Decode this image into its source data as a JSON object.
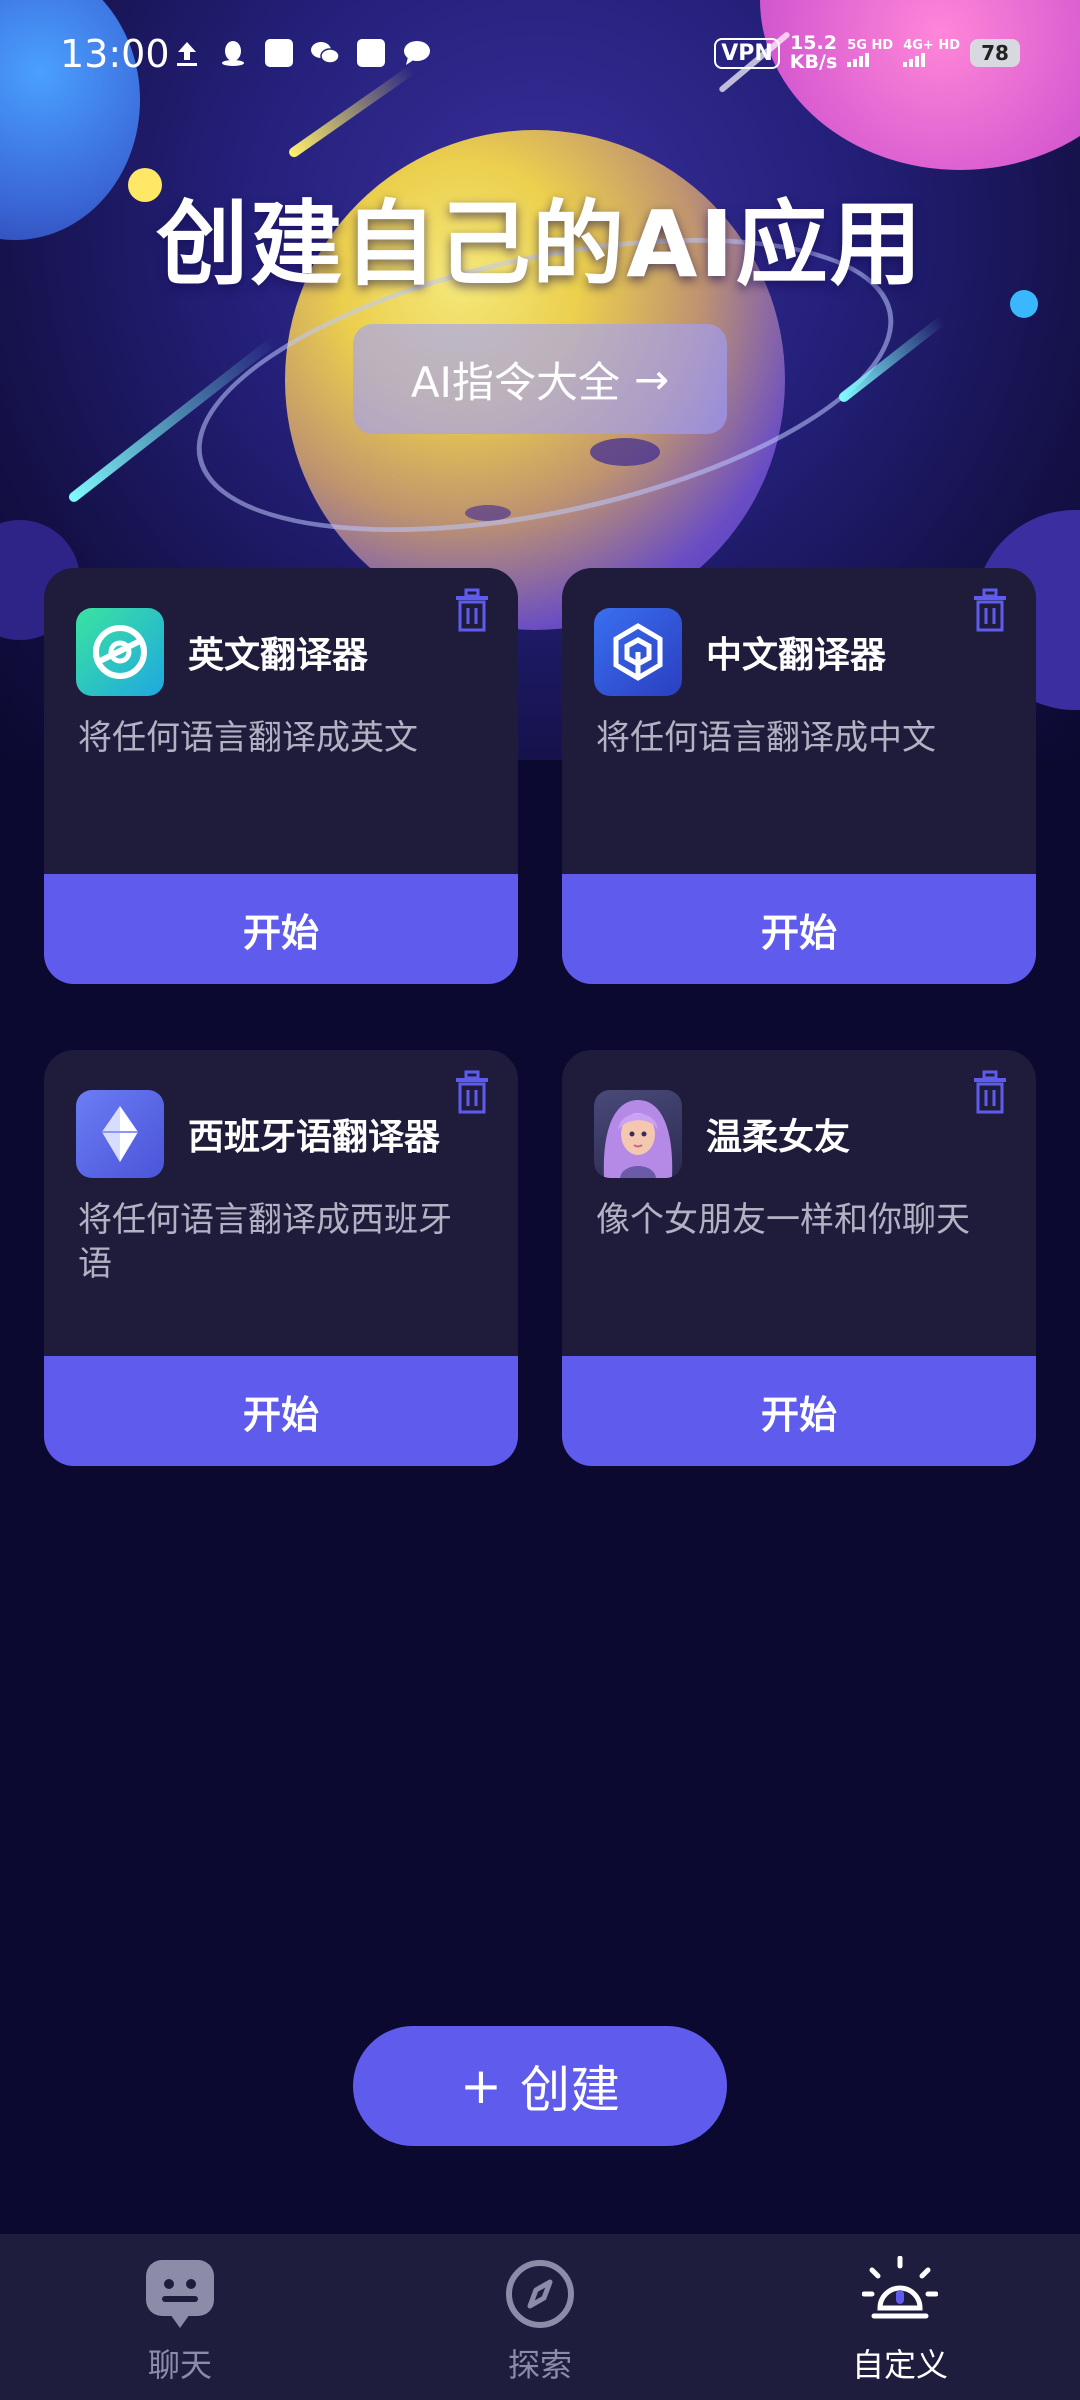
{
  "status_bar": {
    "time": "13:00",
    "vpn": "VPN",
    "net_speed_value": "15.2",
    "net_speed_unit": "KB/s",
    "signal_1": "5G HD",
    "signal_2": "4G+ HD",
    "battery": "78"
  },
  "hero": {
    "title": "创建自己的AI应用",
    "button_label": "AI指令大全",
    "button_arrow": "→"
  },
  "cards": [
    {
      "title": "英文翻译器",
      "description": "将任何语言翻译成英文",
      "start_label": "开始",
      "icon": "english-translator-icon"
    },
    {
      "title": "中文翻译器",
      "description": "将任何语言翻译成中文",
      "start_label": "开始",
      "icon": "chinese-translator-icon"
    },
    {
      "title": "西班牙语翻译器",
      "description": "将任何语言翻译成西班牙语",
      "start_label": "开始",
      "icon": "spanish-translator-icon"
    },
    {
      "title": "温柔女友",
      "description": "像个女朋友一样和你聊天",
      "start_label": "开始",
      "icon": "girlfriend-avatar-icon"
    }
  ],
  "create_button": {
    "plus": "+",
    "label": "创建"
  },
  "bottom_nav": {
    "items": [
      {
        "label": "聊天",
        "icon": "chat-icon",
        "active": false
      },
      {
        "label": "探索",
        "icon": "compass-icon",
        "active": false
      },
      {
        "label": "自定义",
        "icon": "lightbulb-icon",
        "active": true
      }
    ]
  },
  "colors": {
    "background": "#0b0930",
    "card": "#1e1c3a",
    "accent": "#5f5ced",
    "nav_bg": "#1f1d3d"
  }
}
